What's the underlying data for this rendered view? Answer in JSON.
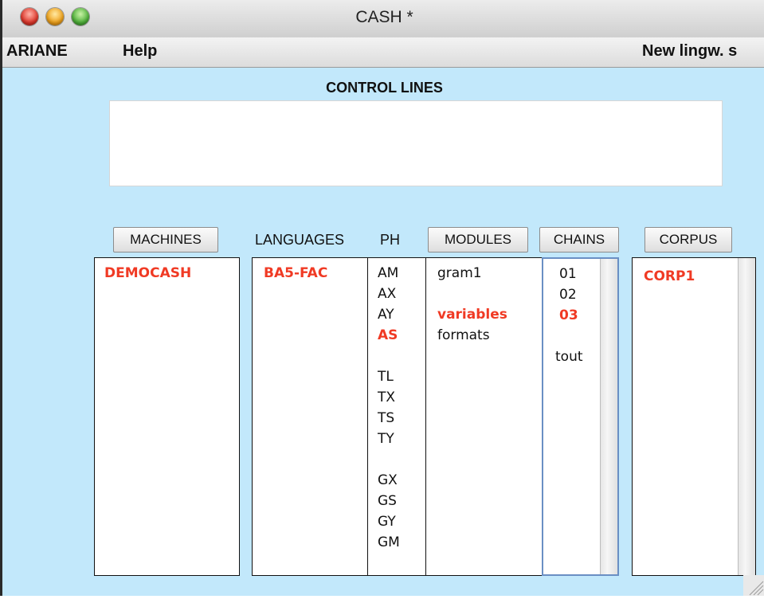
{
  "window": {
    "title": "CASH *"
  },
  "menubar": {
    "items": [
      "ARIANE",
      "Help"
    ],
    "right_text": "New lingw. s"
  },
  "control_lines": {
    "label": "CONTROL LINES",
    "value": ""
  },
  "columns": {
    "machines_button": "MACHINES",
    "languages_label": "LANGUAGES",
    "ph_label": "PH",
    "modules_button": "MODULES",
    "chains_button": "CHAINS",
    "corpus_button": "CORPUS"
  },
  "lists": {
    "machines": [
      {
        "text": "DEMOCASH",
        "selected": true
      }
    ],
    "languages": [
      {
        "text": "BA5-FAC",
        "selected": true
      }
    ],
    "phases": [
      {
        "text": "AM",
        "selected": false
      },
      {
        "text": "AX",
        "selected": false
      },
      {
        "text": "AY",
        "selected": false
      },
      {
        "text": "AS",
        "selected": true
      },
      {
        "text": "",
        "selected": false
      },
      {
        "text": "TL",
        "selected": false
      },
      {
        "text": "TX",
        "selected": false
      },
      {
        "text": "TS",
        "selected": false
      },
      {
        "text": "TY",
        "selected": false
      },
      {
        "text": "",
        "selected": false
      },
      {
        "text": "GX",
        "selected": false
      },
      {
        "text": "GS",
        "selected": false
      },
      {
        "text": "GY",
        "selected": false
      },
      {
        "text": "GM",
        "selected": false
      }
    ],
    "modules": [
      {
        "text": "gram1",
        "selected": false
      },
      {
        "text": "",
        "selected": false
      },
      {
        "text": "variables",
        "selected": true
      },
      {
        "text": "formats",
        "selected": false
      }
    ],
    "chains": [
      {
        "text": "01",
        "selected": false
      },
      {
        "text": "02",
        "selected": false
      },
      {
        "text": "03",
        "selected": true
      },
      {
        "text": "",
        "selected": false
      },
      {
        "text": "tout",
        "selected": false
      }
    ],
    "corpus": [
      {
        "text": "CORP1",
        "selected": true
      }
    ]
  },
  "colors": {
    "background": "#c2e8fb",
    "selected_text": "#f03a24",
    "focus_border": "#6a8fc4"
  }
}
